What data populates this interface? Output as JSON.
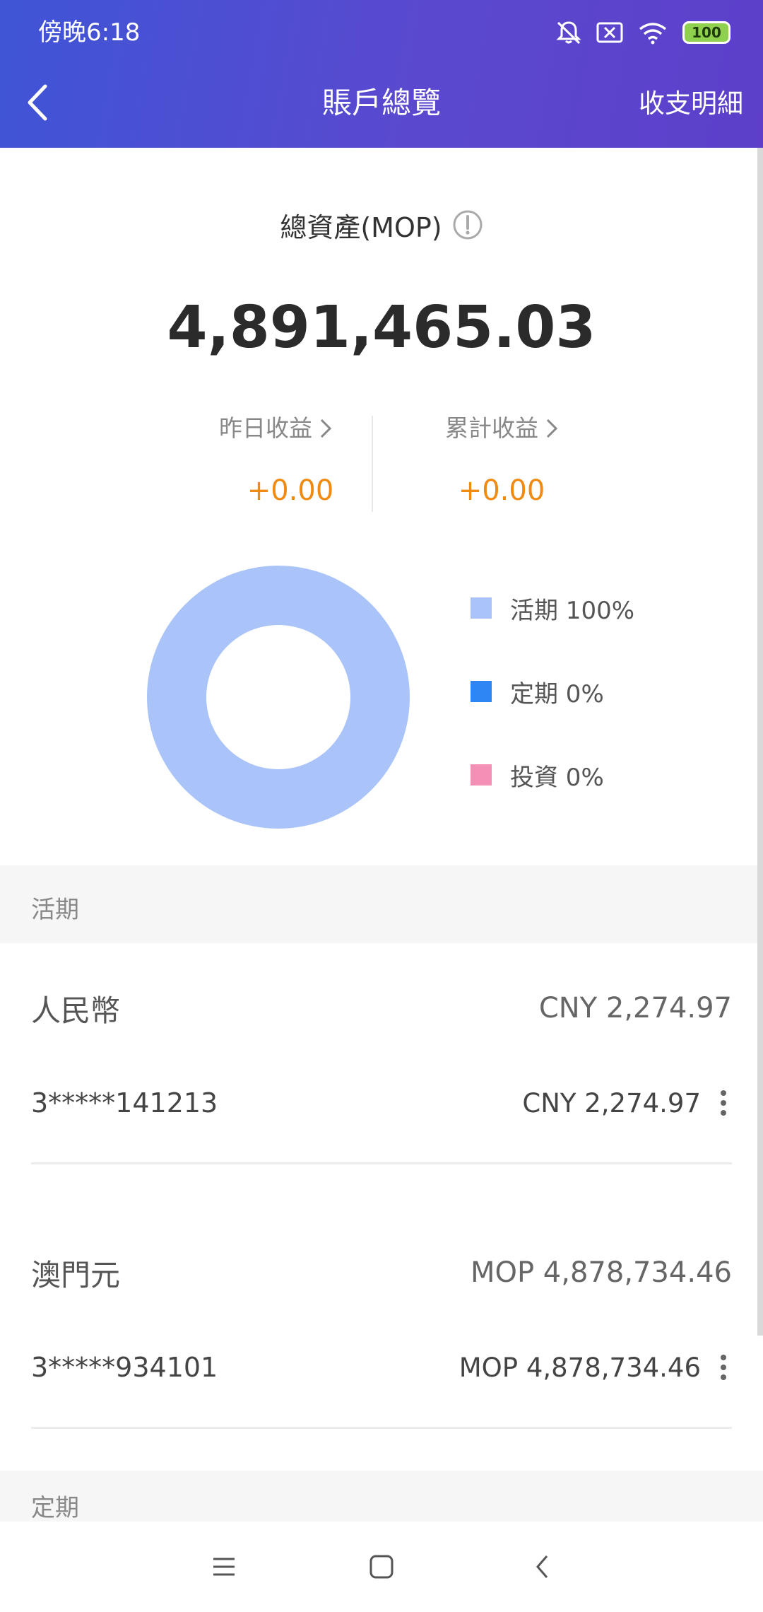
{
  "status_bar": {
    "time": "傍晚6:18",
    "battery": "100",
    "icons": [
      "mute-bell-icon",
      "sim-error-icon",
      "wifi-icon",
      "battery-icon"
    ]
  },
  "header": {
    "back_icon": "chevron-left-icon",
    "title": "賬戶總覽",
    "action_label": "收支明細"
  },
  "summary": {
    "total_label": "總資產(MOP)",
    "total_value": "4,891,465.03",
    "yesterday_label": "昨日收益",
    "yesterday_value": "+0.00",
    "cumulative_label": "累計收益",
    "cumulative_value": "+0.00"
  },
  "chart_data": {
    "type": "pie",
    "categories": [
      "活期",
      "定期",
      "投資"
    ],
    "values": [
      100,
      0,
      0
    ],
    "colors": [
      "#aac4fa",
      "#2d86f3",
      "#f58fb6"
    ],
    "labels": [
      "活期 100%",
      "定期 0%",
      "投資 0%"
    ]
  },
  "sections": {
    "demand_title": "活期",
    "fixed_title": "定期"
  },
  "accounts": [
    {
      "currency": "人民幣",
      "currency_total": "CNY 2,274.97",
      "account_number": "3*****141213",
      "balance": "CNY 2,274.97"
    },
    {
      "currency": "澳門元",
      "currency_total": "MOP 4,878,734.46",
      "account_number": "3*****934101",
      "balance": "MOP 4,878,734.46"
    }
  ],
  "system_nav": {
    "icons": [
      "menu-icon",
      "home-icon",
      "back-icon"
    ]
  }
}
